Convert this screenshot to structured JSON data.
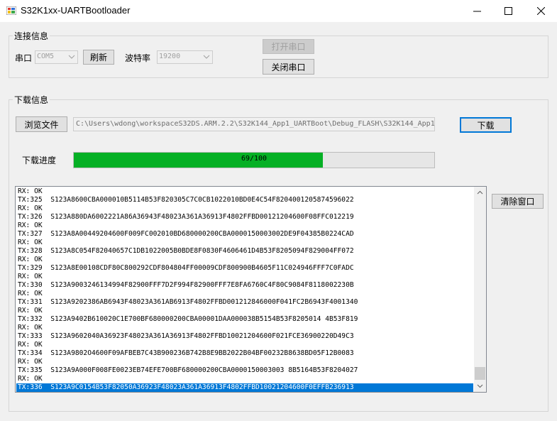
{
  "window": {
    "title": "S32K1xx-UARTBootloader",
    "minimize_icon": "minimize-icon",
    "maximize_icon": "maximize-icon",
    "close_icon": "close-icon"
  },
  "connection": {
    "group_label": "连接信息",
    "port_label": "串口",
    "port_value": "COM5",
    "refresh_label": "刷新",
    "baud_label": "波特率",
    "baud_value": "19200",
    "open_label": "打开串口",
    "close_label": "关闭串口"
  },
  "download": {
    "group_label": "下载信息",
    "browse_label": "浏览文件",
    "file_path": "C:\\Users\\wdong\\workspaceS32DS.ARM.2.2\\S32K144_App1_UARTBoot\\Debug_FLASH\\S32K144_App1",
    "download_label": "下载",
    "progress_label": "下载进度",
    "progress_text": "69/100",
    "progress_value": 0.69,
    "clear_label": "清除窗口"
  },
  "log": {
    "lines": [
      "RX: OK",
      "TX:325  S123A8600CBA000010B5114B53F820305C7C0CB1022010BD0E4C54F8204001205874596022",
      "RX: OK",
      "TX:326  S123A880DA6002221A86A36943F48023A361A36913F4802FFBD00121204600F08FFC012219",
      "RX: OK",
      "TX:327  S123A8A00449204600F009FC002010BD680000200CBA0000150003002DE9F04385B0224CAD",
      "RX: OK",
      "TX:328  S123A8C054F82040657C1DB1022005B0BDE8F0830F4606461D4B53F8205094F829004FF072",
      "RX: OK",
      "TX:329  S123A8E00108CDF80C800292CDF804804FF00009CDF800900B4605F11C024946FFF7C0FADC",
      "RX: OK",
      "TX:330  S123A9003246134994F82900FFF7D2F994F82900FFF7E8FA6760C4F80C9084F8118002230B",
      "RX: OK",
      "TX:331  S123A9202386AB6943F48023A361AB6913F4802FFBD001212846000F041FC2B6943F4001340",
      "RX: OK",
      "TX:332  S123A9402B610020C1E700BF680000200CBA00001DAA000038B5154B53F8205014 4B53F819",
      "RX: OK",
      "TX:333  S123A9602040A36923F48023A361A36913F4802FFBD10021204600F021FCE36900220D49C3",
      "RX: OK",
      "TX:334  S123A9802O4600F09AFBEB7C43B900236B742B8E9BB2022B04BF00232B8638BD05F12B0083",
      "RX: OK",
      "TX:335  S123A9A000F008FE0023EB74EFE700BF680000200CBA0000150003003 8B5164B53F8204027",
      "RX: OK",
      "TX:336  S123A9C0154B53F82050A36923F48023A361A36913F4802FFBD10021204600F0EFFB236913"
    ],
    "selected_index": 23
  }
}
